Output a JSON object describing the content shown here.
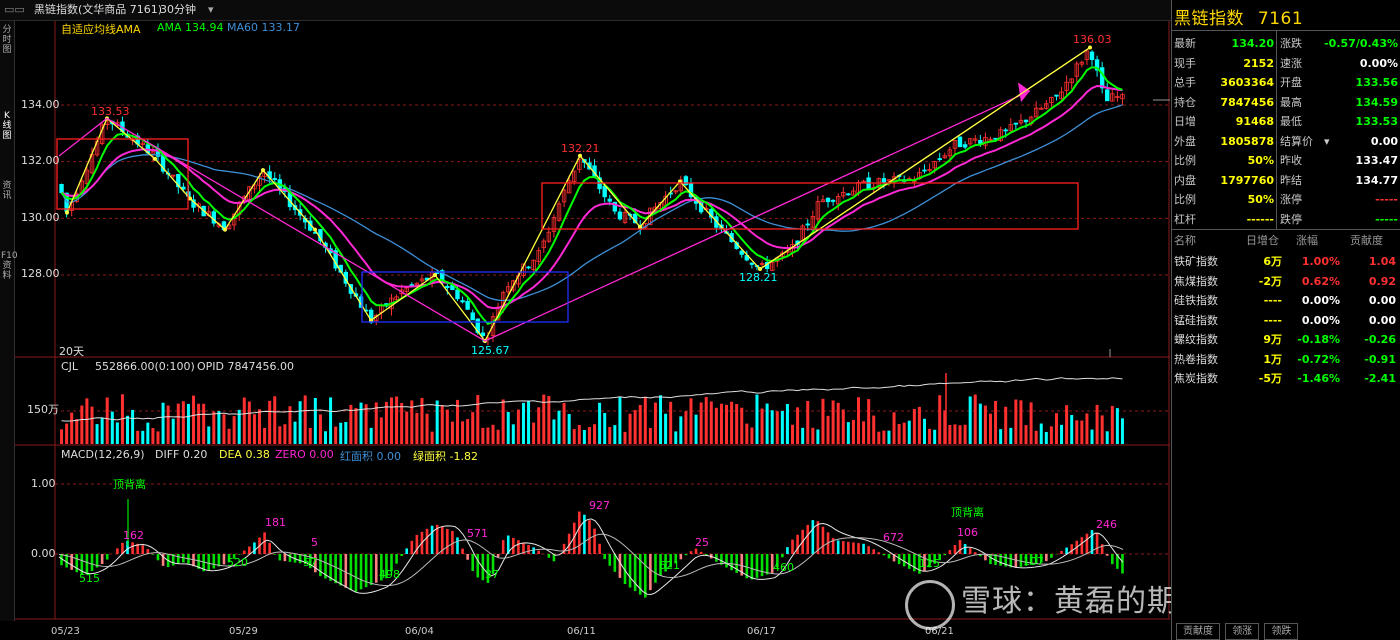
{
  "window": {
    "title": "黑链指数(文华商品 7161)",
    "period": "30分钟",
    "period_arrow": "▾"
  },
  "left_tabs": [
    "分时图",
    "K线图",
    "资讯",
    "F10资料"
  ],
  "main_chart": {
    "legend_prefix": "自适应均线AMA",
    "ama": "AMA 134.94",
    "ma60": "MA60 133.17",
    "y_ticks": [
      "134.00",
      "132.00",
      "130.00",
      "128.00"
    ],
    "price_labels": [
      "133.53",
      "132.21",
      "136.03",
      "128.21",
      "125.67"
    ],
    "days_label": "20天"
  },
  "volume": {
    "label": "CJL",
    "value": "552866.00(0:100)",
    "opid": "OPID 7847456.00",
    "y_tick": "150万"
  },
  "macd": {
    "label": "MACD(12,26,9)",
    "diff": "DIFF 0.20",
    "dea": "DEA 0.38",
    "zero": "ZERO 0.00",
    "red_area": "红面积 0.00",
    "green_area": "绿面积 -1.82",
    "y_ticks": [
      "1.00",
      "0.00"
    ],
    "annotations": [
      "顶背离",
      "顶背离"
    ],
    "area_numbers_red": [
      "181",
      "5",
      "571",
      "927",
      "672",
      "106",
      "246",
      "162",
      "25"
    ],
    "area_numbers_green": [
      "515",
      "520",
      "57",
      "498",
      "37",
      "621",
      "460",
      "125",
      "107"
    ]
  },
  "dates": [
    "05/23",
    "05/29",
    "06/04",
    "06/11",
    "06/17",
    "06/21"
  ],
  "quote": {
    "name": "黑链指数",
    "code": "7161",
    "left": [
      {
        "k": "最新",
        "v": "134.20",
        "c": "#00ff00"
      },
      {
        "k": "现手",
        "v": "2152",
        "c": "#ffff00"
      },
      {
        "k": "总手",
        "v": "3603364",
        "c": "#ffff00"
      },
      {
        "k": "持仓",
        "v": "7847456",
        "c": "#ffff00"
      },
      {
        "k": "日增",
        "v": "91468",
        "c": "#ffff00"
      },
      {
        "k": "外盘",
        "v": "1805878",
        "c": "#ffff00"
      },
      {
        "k": "比例",
        "v": "50%",
        "c": "#ffff00"
      },
      {
        "k": "内盘",
        "v": "1797760",
        "c": "#ffff00"
      },
      {
        "k": "比例",
        "v": "50%",
        "c": "#ffff00"
      },
      {
        "k": "杠杆",
        "v": "------",
        "c": "#ffff00"
      }
    ],
    "right": [
      {
        "k": "涨跌",
        "v": "-0.57/0.43%",
        "c": "#00ff00"
      },
      {
        "k": "速涨",
        "v": "0.00%",
        "c": "#ffffff"
      },
      {
        "k": "开盘",
        "v": "133.56",
        "c": "#00ff00"
      },
      {
        "k": "最高",
        "v": "134.59",
        "c": "#00ff00"
      },
      {
        "k": "最低",
        "v": "133.53",
        "c": "#00ff00"
      },
      {
        "k": "结算价",
        "v": "0.00",
        "c": "#ffffff"
      },
      {
        "k": "昨收",
        "v": "133.47",
        "c": "#ffffff"
      },
      {
        "k": "昨结",
        "v": "134.77",
        "c": "#ffffff"
      },
      {
        "k": "涨停",
        "v": "-----",
        "c": "#ff3030"
      },
      {
        "k": "跌停",
        "v": "-----",
        "c": "#00ff00"
      }
    ],
    "settle_arrow": "▾"
  },
  "components": {
    "headers": [
      "名称",
      "日增仓",
      "涨幅",
      "贡献度"
    ],
    "rows": [
      {
        "name": "铁矿指数",
        "inc": "6万",
        "chg": "1.00%",
        "con": "1.04",
        "cc": "#ff3030"
      },
      {
        "name": "焦煤指数",
        "inc": "-2万",
        "chg": "0.62%",
        "con": "0.92",
        "cc": "#ff3030"
      },
      {
        "name": "硅铁指数",
        "inc": "----",
        "chg": "0.00%",
        "con": "0.00",
        "cc": "#ffffff"
      },
      {
        "name": "锰硅指数",
        "inc": "----",
        "chg": "0.00%",
        "con": "0.00",
        "cc": "#ffffff"
      },
      {
        "name": "螺纹指数",
        "inc": "9万",
        "chg": "-0.18%",
        "con": "-0.26",
        "cc": "#00ff00"
      },
      {
        "name": "热卷指数",
        "inc": "1万",
        "chg": "-0.72%",
        "con": "-0.91",
        "cc": "#00ff00"
      },
      {
        "name": "焦炭指数",
        "inc": "-5万",
        "chg": "-1.46%",
        "con": "-2.41",
        "cc": "#00ff00"
      }
    ]
  },
  "bottom_tabs": [
    "贡献度",
    "领涨",
    "领跌"
  ],
  "watermark": "雪球：黄磊的期货人生",
  "colors": {
    "up": "#ff3030",
    "down": "#00ffff",
    "ama": "#00ff00",
    "ma60": "#3d8fd6",
    "pink": "#ff28d4",
    "yellow": "#ffff40",
    "grid": "#8a1a1a"
  }
}
